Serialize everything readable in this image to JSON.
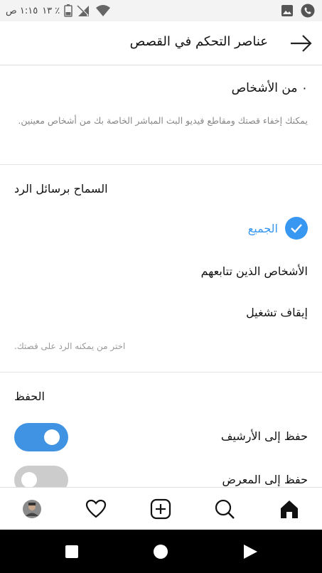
{
  "status_bar": {
    "time": "١:١٥ ص",
    "battery": "١٣ ٪"
  },
  "header": {
    "title": "عناصر التحكم في القصص"
  },
  "hide_story": {
    "count_label": "٠ من الأشخاص",
    "description": "يمكنك إخفاء قصتك ومقاطع فيديو البث المباشر الخاصة بك من أشخاص معينين."
  },
  "replies": {
    "title": "السماح برسائل الرد",
    "options": [
      {
        "label": "الجميع",
        "selected": true
      },
      {
        "label": "الأشخاص الذين تتابعهم",
        "selected": false
      },
      {
        "label": "إيقاف تشغيل",
        "selected": false
      }
    ],
    "hint": "اختر من يمكنه الرد على قصتك."
  },
  "saving": {
    "title": "الحفظ",
    "items": [
      {
        "label": "حفظ إلى الأرشيف",
        "enabled": true
      },
      {
        "label": "حفظ إلى المعرض",
        "enabled": false
      }
    ]
  },
  "bottom_nav": {
    "items": [
      "home-icon",
      "search-icon",
      "add-post-icon",
      "heart-icon",
      "profile-avatar"
    ]
  },
  "colors": {
    "accent": "#3897f0",
    "toggle_on": "#3f93e2",
    "toggle_off": "#cccccc"
  }
}
